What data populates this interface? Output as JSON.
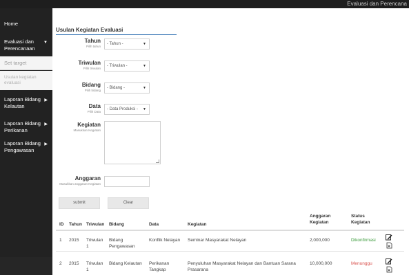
{
  "header": {
    "title": "Evaluasi dan Perencana"
  },
  "sidebar": {
    "items": [
      {
        "label": "Home",
        "caret": ""
      },
      {
        "label": "Evaluasi dan Perencanaan",
        "caret": "▼"
      },
      {
        "label": "Set target",
        "caret": ""
      },
      {
        "label": "Usulan kegiatan evaluasi",
        "caret": ""
      },
      {
        "label": "Laporan Bidang Kelautan",
        "caret": "▶"
      },
      {
        "label": "Laporan Bidang Perikanan",
        "caret": "▶"
      },
      {
        "label": "Laporan Bidang Pengawasan",
        "caret": "▶"
      }
    ]
  },
  "form": {
    "title": "Usulan Kegiatan Evaluasi",
    "tahun": {
      "label": "Tahun",
      "hint": "Pilih tahun",
      "value": "- Tahun -"
    },
    "triwulan": {
      "label": "Triwulan",
      "hint": "Pilih triwulan",
      "value": "- Triwulan -"
    },
    "bidang": {
      "label": "Bidang",
      "hint": "Pilih bidang",
      "value": "- Bidang -"
    },
    "data": {
      "label": "Data",
      "hint": "Pilih Data",
      "value": "- Data Produksi -"
    },
    "kegiatan": {
      "label": "Kegiatan",
      "hint": "Masukkan Kegiatan",
      "value": ""
    },
    "anggaran": {
      "label": "Anggaran",
      "hint": "Masukkan anggaran Kegiatan",
      "value": ""
    },
    "submit_label": "submit",
    "clear_label": "Clear"
  },
  "table": {
    "headers": {
      "id": "ID",
      "tahun": "Tahun",
      "triwulan": "Triwulan",
      "bidang": "Bidang",
      "data": "Data",
      "kegiatan": "Kegiatan",
      "anggaran_l1": "Anggaran",
      "anggaran_l2": "Kegiatan",
      "status_l1": "Status",
      "status_l2": "Kegiatan"
    },
    "rows": [
      {
        "id": "1",
        "tahun": "2015",
        "triwulan_l1": "Triwulan",
        "triwulan_l2": "1",
        "bidang_l1": "Bidang",
        "bidang_l2": "Pengawasan",
        "data_l1": "Konflik Nelayan",
        "data_l2": "",
        "kegiatan_l1": "Seminar Masyarakat Nelayan",
        "kegiatan_l2": "",
        "anggaran": "2,000,000",
        "status": "Dikonfirmasi",
        "status_color": "#3c9b3c"
      },
      {
        "id": "2",
        "tahun": "2015",
        "triwulan_l1": "Triwulan",
        "triwulan_l2": "1",
        "bidang_l1": "Bidang Kelautan",
        "bidang_l2": "",
        "data_l1": "Perikanan",
        "data_l2": "Tangkap",
        "kegiatan_l1": "Penyuluhan Masyarakat Nelayan dan Bantuan Sarana",
        "kegiatan_l2": "Prasarana",
        "anggaran": "10,000,000",
        "status": "Menunggu",
        "status_color": "#d9534f"
      }
    ]
  },
  "colors": {
    "sidebar_bg": "#222222",
    "accent_line": "#2b6cb0",
    "status_ok": "#3c9b3c",
    "status_wait": "#d9534f"
  },
  "icons": [
    "edit-icon",
    "delete-icon",
    "dropdown-arrow-icon",
    "resize-grip-icon"
  ]
}
